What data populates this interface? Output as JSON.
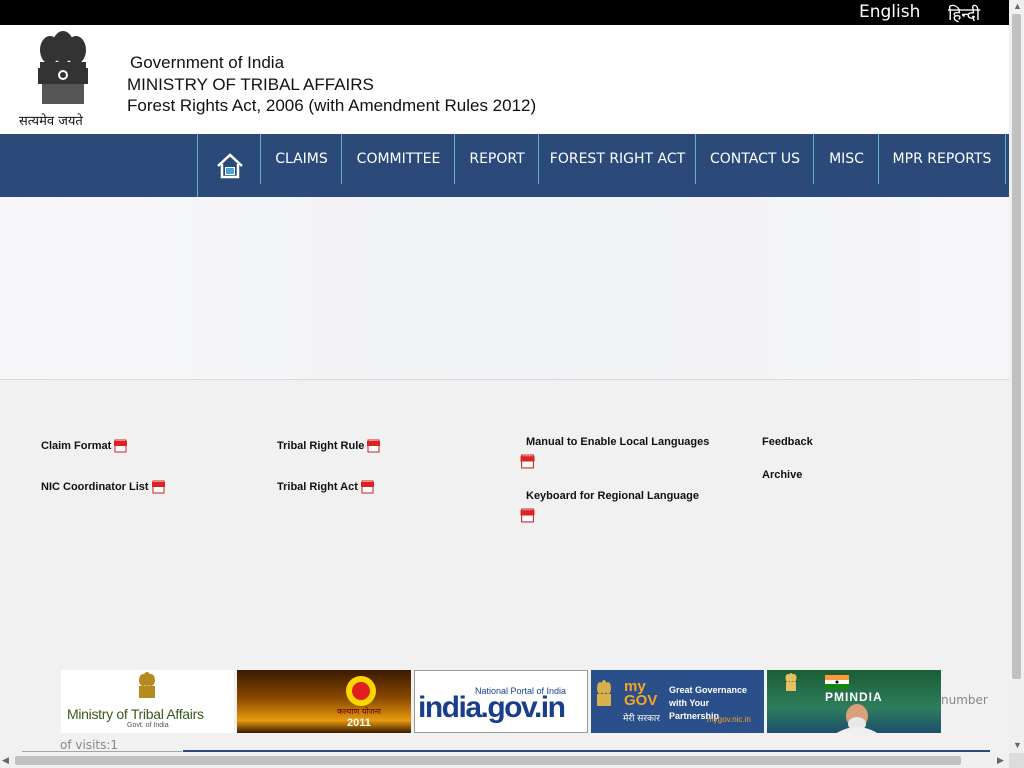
{
  "languages": {
    "english": "English",
    "hindi": "हिन्दी"
  },
  "header": {
    "emblem_motto": "सत्यमेव जयते",
    "gov_title": "Government of India",
    "ministry": "MINISTRY OF TRIBAL AFFAIRS",
    "act": "Forest Rights Act, 2006 (with Amendment Rules 2012)"
  },
  "nav": {
    "home_icon": "home-icon",
    "items": [
      "CLAIMS",
      "COMMITTEE",
      "REPORT",
      "FOREST RIGHT ACT",
      "CONTACT US",
      "MISC",
      "MPR REPORTS"
    ]
  },
  "links": {
    "claim_format": "Claim Format",
    "nic_coordinator": "NIC Coordinator List",
    "tribal_right_rule": "Tribal Right Rule",
    "tribal_right_act": "Tribal Right Act",
    "manual_languages": "Manual to Enable Local Languages",
    "keyboard_regional": "Keyboard for Regional Language",
    "feedback": "Feedback",
    "archive": "Archive",
    "pdf_badge": "PDF"
  },
  "footer_logos": {
    "mota_title": "Ministry of Tribal Affairs",
    "mota_sub": "Govt. of India",
    "yojana_text": "कल्याण योजना",
    "yojana_year": "2011",
    "india_portal_top": "National Portal of India",
    "india_portal_main": "india.gov.in",
    "mygov_logo": "my GOV",
    "mygov_tagline": "Great Governance with Your Partnership",
    "mygov_hindi": "मेरी सरकार",
    "mygov_url": "mygov.nic.in",
    "pmindia": "PMINDIA"
  },
  "visits": {
    "part1": "number",
    "part2": "of visits:1"
  },
  "colors": {
    "nav_bg": "#2b4a7a",
    "divider": "#5fb6c8",
    "top_bar": "#000000"
  }
}
